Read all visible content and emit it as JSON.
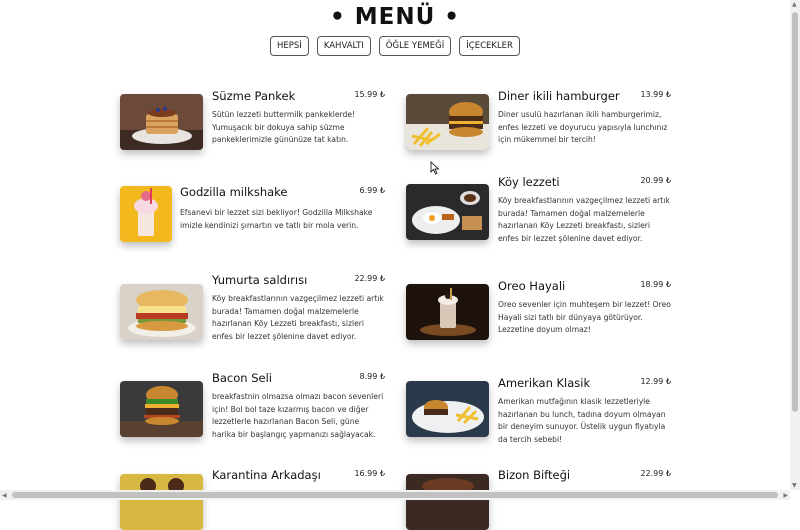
{
  "header": {
    "title": "• MENÜ •"
  },
  "filters": [
    "HEPSİ",
    "KAHVALTI",
    "ÖĞLE YEMEĞİ",
    "İÇECEKLER"
  ],
  "menu": {
    "items": [
      {
        "title": "Süzme Pankek",
        "price": "15.99 ₺",
        "desc": "Sütün lezzeti buttermilk pankeklerde! Yumuşacık bir dokuya sahip süzme pankeklerimizle gününüze tat katın."
      },
      {
        "title": "Diner ikili hamburger",
        "price": "13.99 ₺",
        "desc": "Diner usulü hazırlanan ikili hamburgerimiz, enfes lezzeti ve doyurucu yapısıyla lunchınız için mükemmel bir tercih!"
      },
      {
        "title": "Godzilla milkshake",
        "price": "6.99 ₺",
        "desc": "Efsanevi bir lezzet sizi bekliyor! Godzilla Milkshake imizle kendinizi şımartın ve tatlı bir mola verin."
      },
      {
        "title": "Köy lezzeti",
        "price": "20.99 ₺",
        "desc": "Köy breakfastlarının vazgeçilmez lezzeti artık burada! Tamamen doğal malzemelerle hazırlanan Köy Lezzeti breakfastı, sizleri enfes bir lezzet şölenine davet ediyor."
      },
      {
        "title": "Yumurta saldırısı",
        "price": "22.99 ₺",
        "desc": "Köy breakfastlarının vazgeçilmez lezzeti artık burada! Tamamen doğal malzemelerle hazırlanan Köy Lezzeti breakfastı, sizleri enfes bir lezzet şölenine davet ediyor."
      },
      {
        "title": "Oreo Hayali",
        "price": "18.99 ₺",
        "desc": "Oreo sevenler için muhteşem bir lezzet! Oreo Hayali sizi tatlı bir dünyaya götürüyor. Lezzetine doyum olmaz!"
      },
      {
        "title": "Bacon Seli",
        "price": "8.99 ₺",
        "desc": "breakfastnin olmazsa olmazı bacon sevenleri için! Bol bol taze kızarmış bacon ve diğer lezzetlerle hazırlanan Bacon Seli, güne harika bir başlangıç yapmanızı sağlayacak."
      },
      {
        "title": "Amerikan Klasik",
        "price": "12.99 ₺",
        "desc": "Amerikan mutfağının klasik lezzetleriyle hazırlanan bu lunch, tadına doyum olmayan bir deneyim sunuyor. Üstelik uygun fiyatıyla da tercih sebebi!"
      },
      {
        "title": "Karantina Arkadaşı",
        "price": "16.99 ₺",
        "desc": ""
      },
      {
        "title": "Bizon Bifteği",
        "price": "22.99 ₺",
        "desc": ""
      }
    ]
  }
}
